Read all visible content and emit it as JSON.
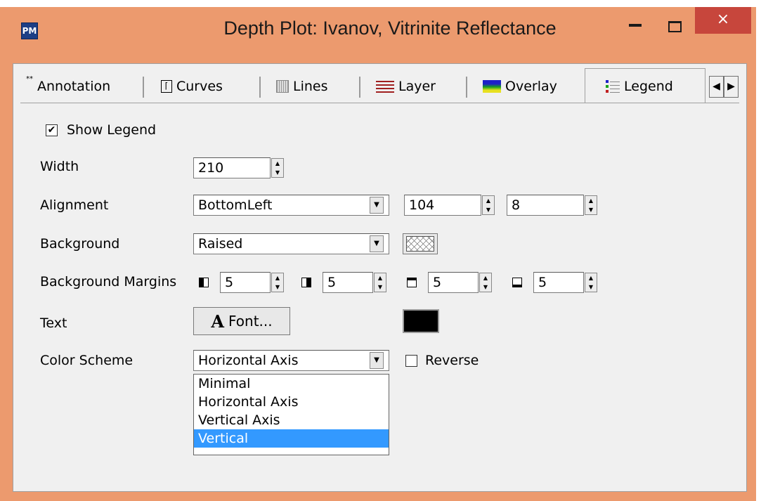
{
  "window": {
    "title": "Depth Plot: Ivanov,  Vitrinite Reflectance",
    "app_icon": "PM",
    "close_symbol": "×"
  },
  "tabs": [
    {
      "label": "Annotation",
      "icon": "annotation-icon",
      "icon_text": "**"
    },
    {
      "label": "Curves",
      "icon": "curves-icon",
      "icon_text": "⌈"
    },
    {
      "label": "Lines",
      "icon": "lines-icon"
    },
    {
      "label": "Layer",
      "icon": "layer-icon"
    },
    {
      "label": "Overlay",
      "icon": "overlay-icon"
    },
    {
      "label": "Legend",
      "icon": "legend-icon",
      "active": true
    }
  ],
  "tab_scroll": {
    "left": "◀",
    "right": "▶"
  },
  "form": {
    "show_legend_label": "Show Legend",
    "show_legend_checked": "✔",
    "width_label": "Width",
    "width_value": "210",
    "alignment_label": "Alignment",
    "alignment_value": "BottomLeft",
    "alignment_x": "104",
    "alignment_y": "8",
    "background_label": "Background",
    "background_value": "Raised",
    "background_margins_label": "Background Margins",
    "margins": [
      "5",
      "5",
      "5",
      "5"
    ],
    "text_label": "Text",
    "font_button_label": "Font...",
    "font_button_icon": "A",
    "text_color": "#000000",
    "color_scheme_label": "Color Scheme",
    "color_scheme_value": "Horizontal Axis",
    "reverse_label": "Reverse",
    "color_scheme_options": [
      "Minimal",
      "Horizontal Axis",
      "Vertical Axis",
      "Vertical"
    ],
    "highlighted_option": "Vertical"
  },
  "colors": {
    "titlebar": "#ec9a6e",
    "close": "#c7463c",
    "selection": "#3399ff"
  }
}
